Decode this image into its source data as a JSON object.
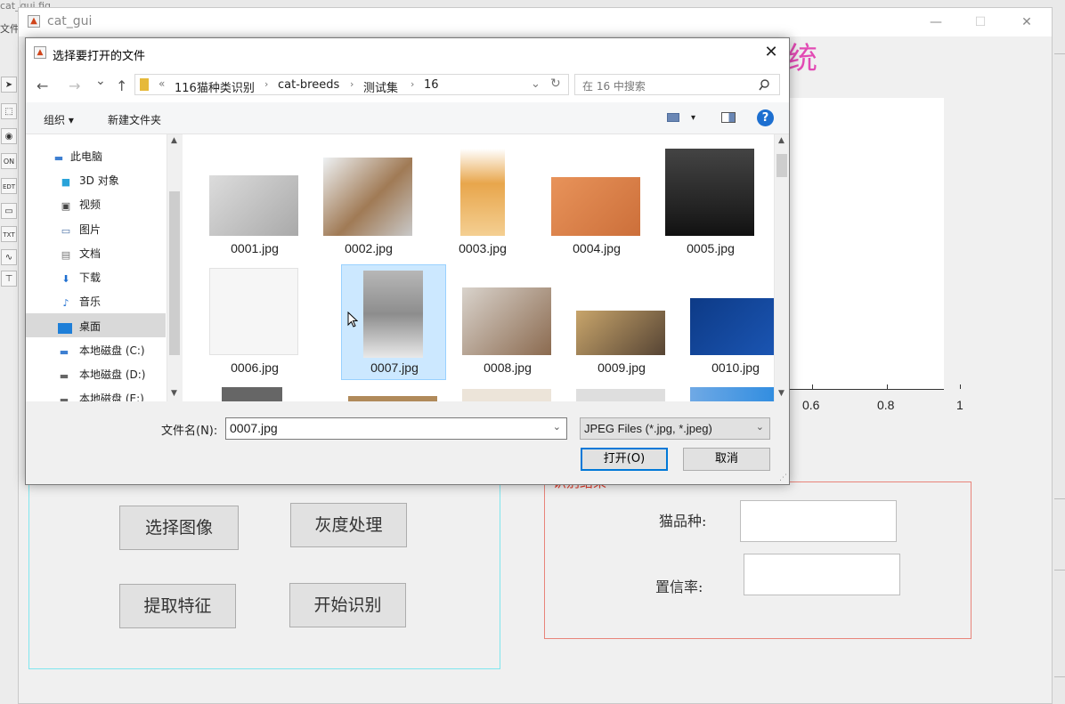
{
  "guide": {
    "title": "cat_gui.fig",
    "menu_label": "文件",
    "tools": [
      "⬚",
      "◉",
      "ON",
      "EDT",
      "▭",
      "TXT",
      "∿",
      "⊤"
    ]
  },
  "gui": {
    "title": "cat_gui",
    "title_fragment": "系统",
    "window_controls": [
      "—",
      "☐",
      "✕"
    ],
    "axis_ticks": [
      "0.6",
      "0.8",
      "1"
    ],
    "buttons": {
      "select_image": "选择图像",
      "gray": "灰度处理",
      "extract": "提取特征",
      "recognize": "开始识别"
    },
    "result": {
      "legend": "识别结果",
      "breed_label": "猫品种:",
      "breed_value": "",
      "confidence_label": "置信率:",
      "confidence_value": ""
    }
  },
  "dialog": {
    "title": "选择要打开的文件",
    "close": "✕",
    "nav": {
      "back": "←",
      "forward": "→",
      "recent": "⌄",
      "up": "↑",
      "refresh": "↻",
      "address_dropdown": "⌄"
    },
    "breadcrumb": [
      "«",
      "116猫种类识别",
      "cat-breeds",
      "测试集",
      "16"
    ],
    "breadcrumb_sep": "›",
    "search_placeholder": "在 16 中搜索",
    "toolbar": {
      "organize": "组织 ▾",
      "new_folder": "新建文件夹",
      "view_dropdown": "▾"
    },
    "nav_items": [
      {
        "label": "此电脑",
        "icon": "computer-icon"
      },
      {
        "label": "3D 对象",
        "icon": "cube-icon"
      },
      {
        "label": "视频",
        "icon": "video-icon"
      },
      {
        "label": "图片",
        "icon": "picture-icon"
      },
      {
        "label": "文档",
        "icon": "document-icon"
      },
      {
        "label": "下载",
        "icon": "download-icon"
      },
      {
        "label": "音乐",
        "icon": "music-icon"
      },
      {
        "label": "桌面",
        "icon": "desktop-icon"
      },
      {
        "label": "本地磁盘 (C:)",
        "icon": "drive-icon"
      },
      {
        "label": "本地磁盘 (D:)",
        "icon": "drive-icon"
      },
      {
        "label": "本地磁盘 (E:)",
        "icon": "drive-icon"
      }
    ],
    "selected_nav": "桌面",
    "files": [
      "0001.jpg",
      "0002.jpg",
      "0003.jpg",
      "0004.jpg",
      "0005.jpg",
      "0006.jpg",
      "0007.jpg",
      "0008.jpg",
      "0009.jpg",
      "0010.jpg"
    ],
    "selected_file": "0007.jpg",
    "filename_label": "文件名(N):",
    "filename_value": "0007.jpg",
    "filter_value": "JPEG Files (*.jpg, *.jpeg)",
    "open_button": "打开(O)",
    "cancel_button": "取消",
    "colors": {
      "accent": "#0078d7",
      "selection": "#cce8ff"
    }
  }
}
